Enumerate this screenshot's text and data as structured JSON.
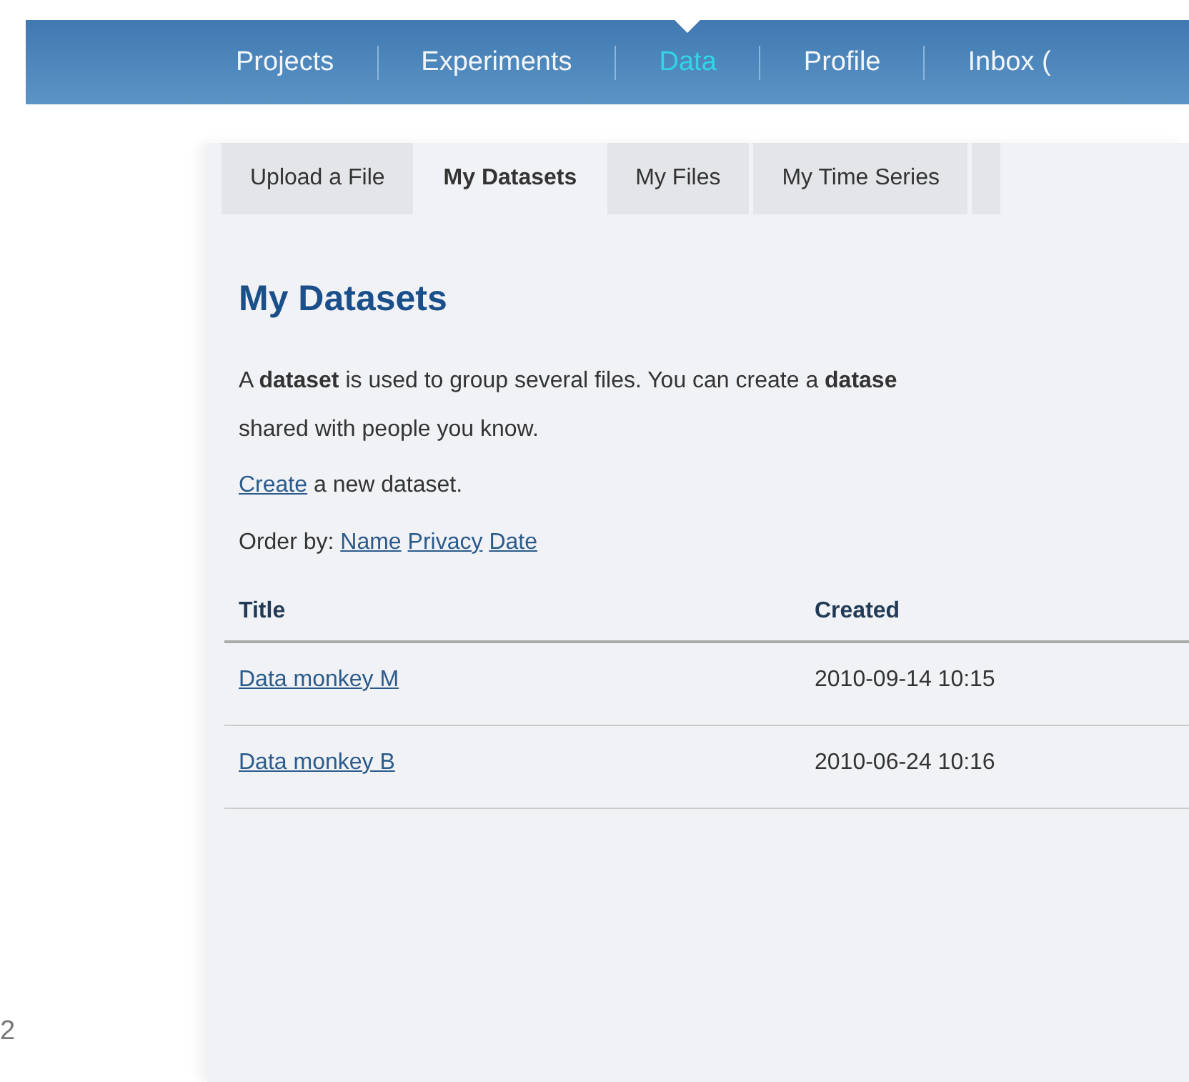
{
  "nav": [
    {
      "label": "Projects",
      "selected": false
    },
    {
      "label": "Experiments",
      "selected": false
    },
    {
      "label": "Data",
      "selected": true
    },
    {
      "label": "Profile",
      "selected": false
    },
    {
      "label": "Inbox (",
      "selected": false
    }
  ],
  "subtabs": [
    {
      "label": "Upload a File",
      "selected": false
    },
    {
      "label": "My Datasets",
      "selected": true
    },
    {
      "label": "My Files",
      "selected": false
    },
    {
      "label": "My Time Series",
      "selected": false
    }
  ],
  "heading": "My Datasets",
  "intro": "A **dataset** is used to group several files. You can create a **datase**\nshared with people you know.",
  "create": {
    "link": "Create",
    "text": "a new dataset."
  },
  "order_by": {
    "label": "Order by:",
    "links": [
      "Name",
      "Privacy",
      "Date"
    ]
  },
  "table": {
    "columns": [
      "Title",
      "Created"
    ],
    "rows": [
      {
        "title": "Data monkey M",
        "created": "2010-09-14 10:15"
      },
      {
        "title": "Data monkey B",
        "created": "2010-06-24 10:16"
      }
    ]
  },
  "footer": "2"
}
